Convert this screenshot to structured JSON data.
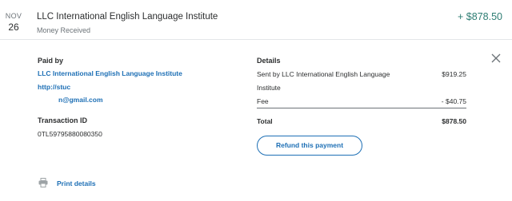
{
  "transaction": {
    "month": "NOV",
    "day": "26",
    "name": "LLC International English Language Institute",
    "type": "Money Received",
    "amount": "+ $878.50"
  },
  "paid_by": {
    "heading": "Paid by",
    "name": "LLC International English Language Institute",
    "website": "http://stuc",
    "email": "n@gmail.com"
  },
  "transaction_id": {
    "heading": "Transaction ID",
    "value": "0TL59795880080350"
  },
  "details": {
    "heading": "Details",
    "sent_by_line1": "Sent by LLC International English Language",
    "sent_by_line2": "Institute",
    "sent_amount": "$919.25",
    "fee_label": "Fee",
    "fee_amount": "- $40.75",
    "total_label": "Total",
    "total_amount": "$878.50"
  },
  "actions": {
    "refund_label": "Refund this payment",
    "print_label": "Print details"
  },
  "colors": {
    "accent": "#1d6fb5",
    "amount_positive": "#2e7d73"
  },
  "icons": {
    "close": "close-icon",
    "print": "printer-icon"
  }
}
